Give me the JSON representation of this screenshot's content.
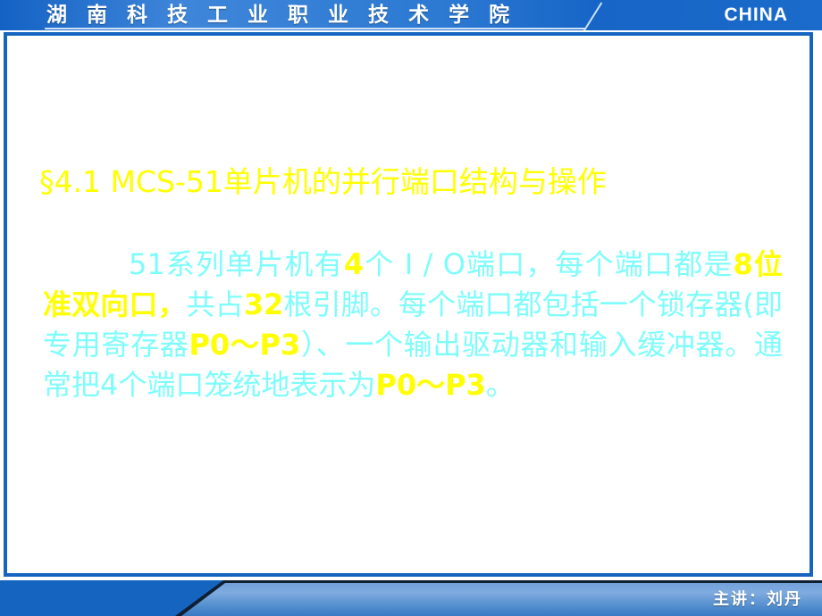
{
  "header": {
    "institution": "湖 南 科 技 工 业 职 业 技 术 学 院",
    "country_label": "CHINA"
  },
  "slide": {
    "title": "§4.1  MCS-51单片机的并行端口结构与操作",
    "body_segments": [
      {
        "text": "51系列单片机有",
        "highlight": false
      },
      {
        "text": "4",
        "highlight": true
      },
      {
        "text": "个 I / O端口，每个端口都是",
        "highlight": false
      },
      {
        "text": "8位准双向口，",
        "highlight": true
      },
      {
        "text": "共占",
        "highlight": false
      },
      {
        "text": "32",
        "highlight": true
      },
      {
        "text": "根引脚。每个端口都包括一个锁存器(即专用寄存器",
        "highlight": false
      },
      {
        "text": "P0～P3",
        "highlight": true
      },
      {
        "text": "）、一个输出驱动器和输入缓冲器。通常把4个端口笼统地表示为",
        "highlight": false
      },
      {
        "text": "P0～P3",
        "highlight": true
      },
      {
        "text": "。",
        "highlight": false
      }
    ]
  },
  "footer": {
    "presenter": "主讲：刘丹"
  },
  "colors": {
    "header_blue": "#1565c0",
    "title_yellow": "#ffff00",
    "body_cyan": "#7efcfc",
    "footer_light": "#7fabdf"
  }
}
